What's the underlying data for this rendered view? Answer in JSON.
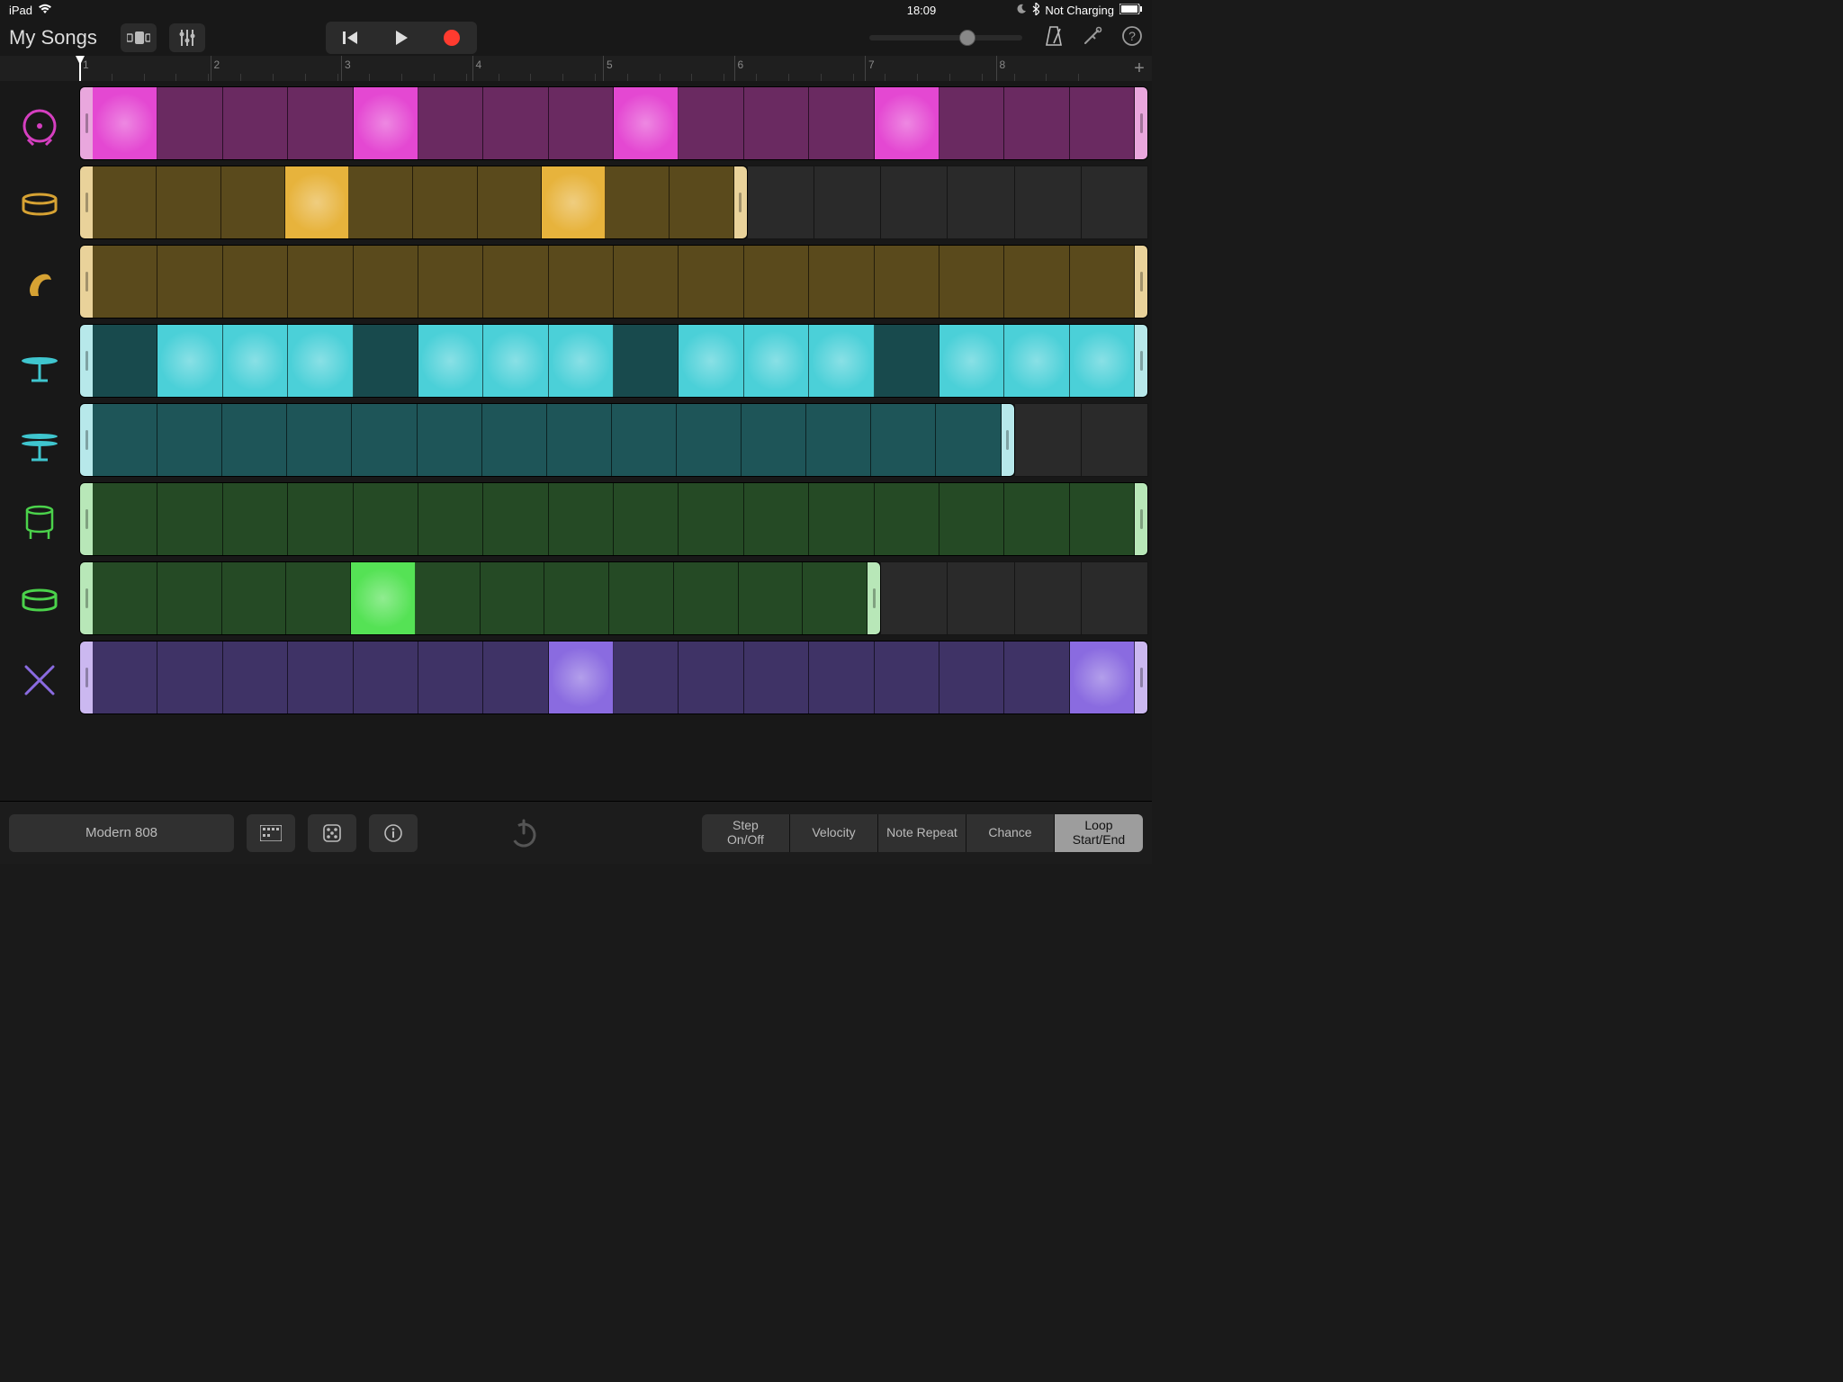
{
  "status": {
    "device": "iPad",
    "time": "18:09",
    "charge_label": "Not Charging"
  },
  "toolbar": {
    "my_songs": "My Songs"
  },
  "ruler": {
    "bars": [
      "1",
      "2",
      "3",
      "4",
      "5",
      "6",
      "7",
      "8"
    ],
    "add": "+"
  },
  "tracks": [
    {
      "name": "kick",
      "icon_color": "#d53fc0",
      "handle_color": "#e9a7dd",
      "off_color": "#6a2a61",
      "on_color": "#e448d2",
      "length": 16,
      "on_steps": [
        0,
        4,
        8,
        12
      ]
    },
    {
      "name": "snare",
      "icon_color": "#d6a233",
      "handle_color": "#e9d29a",
      "off_color": "#5a4a1c",
      "on_color": "#e7b33c",
      "length": 10,
      "on_steps": [
        3,
        7
      ]
    },
    {
      "name": "clap",
      "icon_color": "#d6a233",
      "handle_color": "#e9d29a",
      "off_color": "#5a4a1c",
      "on_color": "#e7b33c",
      "length": 16,
      "on_steps": []
    },
    {
      "name": "hihat-closed",
      "icon_color": "#3fc6cf",
      "handle_color": "#b7e8ea",
      "off_color": "#184a4d",
      "on_color": "#4bd0d8",
      "length": 16,
      "on_steps": [
        1,
        2,
        3,
        5,
        6,
        7,
        9,
        10,
        11,
        13,
        14,
        15
      ]
    },
    {
      "name": "hihat-open",
      "icon_color": "#3fc6cf",
      "handle_color": "#b7e8ea",
      "off_color": "#1e5558",
      "on_color": "#4bd0d8",
      "length": 14,
      "on_steps": []
    },
    {
      "name": "tom",
      "icon_color": "#4bd24b",
      "handle_color": "#b8e7b8",
      "off_color": "#254a25",
      "on_color": "#55e255",
      "length": 16,
      "on_steps": []
    },
    {
      "name": "snare-2",
      "icon_color": "#4bd24b",
      "handle_color": "#b8e7b8",
      "off_color": "#254a25",
      "on_color": "#55e255",
      "length": 12,
      "on_steps": [
        4
      ]
    },
    {
      "name": "sticks",
      "icon_color": "#8a6be0",
      "handle_color": "#cbb8f0",
      "off_color": "#3f3366",
      "on_color": "#8a6be0",
      "length": 16,
      "on_steps": [
        7,
        15
      ]
    }
  ],
  "total_steps": 16,
  "bottom": {
    "kit_name": "Modern 808",
    "modes": [
      {
        "label": "Step\nOn/Off",
        "active": false
      },
      {
        "label": "Velocity",
        "active": false
      },
      {
        "label": "Note Repeat",
        "active": false
      },
      {
        "label": "Chance",
        "active": false
      },
      {
        "label": "Loop\nStart/End",
        "active": true
      }
    ]
  }
}
